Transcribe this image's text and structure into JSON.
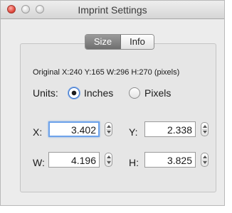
{
  "window": {
    "title": "Imprint Settings"
  },
  "tabs": [
    {
      "label": "Size",
      "selected": true
    },
    {
      "label": "Info",
      "selected": false
    }
  ],
  "original_info": "Original  X:240 Y:165  W:296 H:270 (pixels)",
  "units": {
    "label": "Units:",
    "options": [
      {
        "label": "Inches",
        "selected": true
      },
      {
        "label": "Pixels",
        "selected": false
      }
    ]
  },
  "fields": {
    "x": {
      "label": "X:",
      "value": "3.402"
    },
    "y": {
      "label": "Y:",
      "value": "2.338"
    },
    "w": {
      "label": "W:",
      "value": "4.196"
    },
    "h": {
      "label": "H:",
      "value": "3.825"
    }
  },
  "colors": {
    "close_button": "#e0443a",
    "focus_ring": "#6ea3ea",
    "selected_tab": "#7f7f7f"
  }
}
